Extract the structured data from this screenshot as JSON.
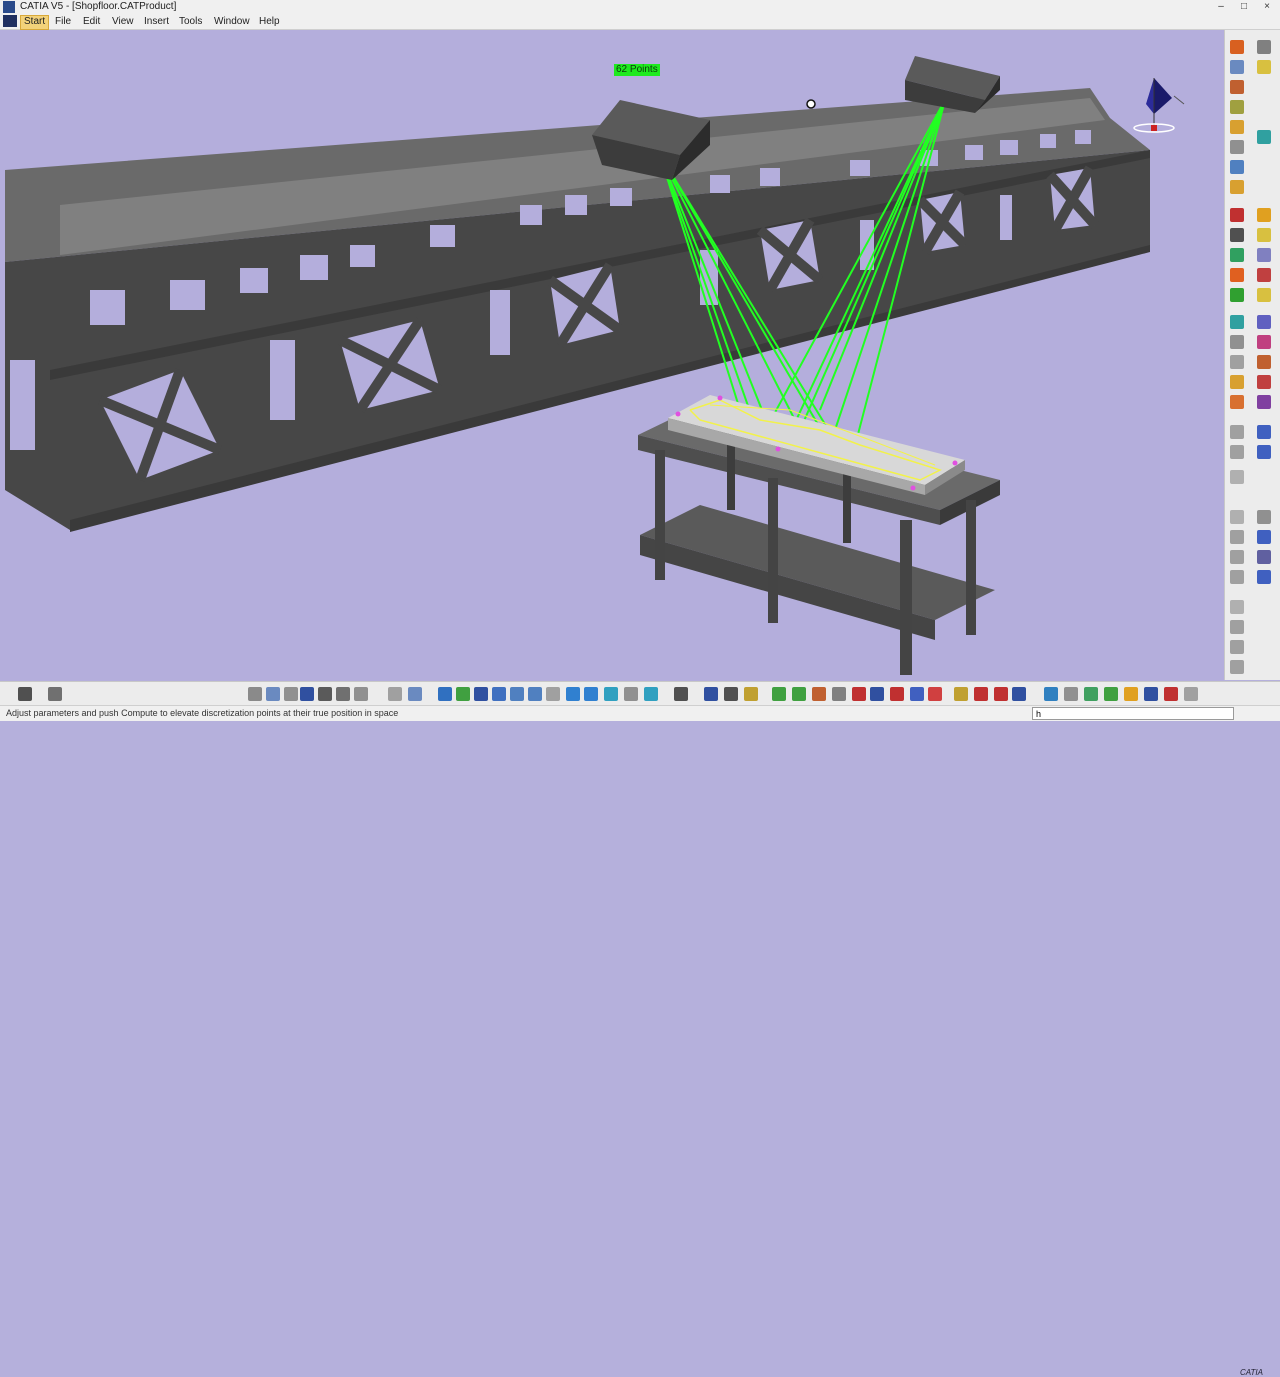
{
  "window": {
    "title": "CATIA V5 - [Shopfloor.CATProduct]",
    "minimize_glyph": "–",
    "maximize_glyph": "□",
    "close_glyph": "×"
  },
  "menu": {
    "items": [
      {
        "label": "Start"
      },
      {
        "label": "File"
      },
      {
        "label": "Edit"
      },
      {
        "label": "View"
      },
      {
        "label": "Insert"
      },
      {
        "label": "Tools"
      },
      {
        "label": "Window"
      },
      {
        "label": "Help"
      }
    ]
  },
  "viewport": {
    "points_badge": "62 Points",
    "background_color": "#b4aedc",
    "beam_color": "#4a4a4a",
    "ray_color": "#22ff22",
    "profile_color": "#f2f24a"
  },
  "status": {
    "message": "Adjust parameters and push Compute to elevate discretization points at their true position in space",
    "command_value": "h"
  },
  "branding": {
    "corner_logo": "CATIA"
  },
  "icons": {
    "right_toolbar": "workbench-tool-icons",
    "bottom_toolbar": "view-and-tool-icons"
  }
}
